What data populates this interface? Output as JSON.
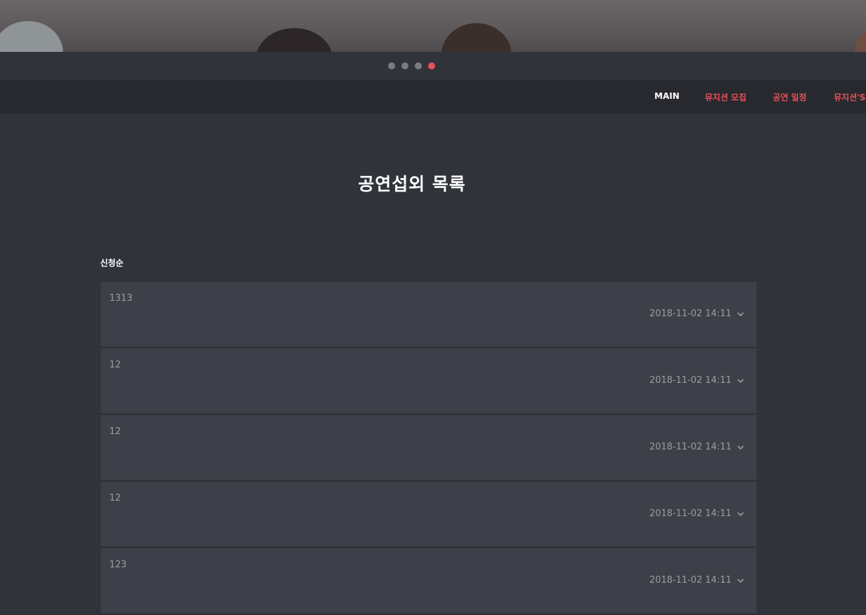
{
  "carousel": {
    "slide_count": 4,
    "active_index": 3,
    "colors": {
      "inactive": "#7a7c82",
      "active": "#e8515a"
    }
  },
  "nav": {
    "items": [
      {
        "label": "MAIN"
      },
      {
        "label": "뮤지션 모집"
      },
      {
        "label": "공연 일정"
      },
      {
        "label": "뮤지션'S"
      }
    ]
  },
  "page": {
    "title": "공연섭외 목록",
    "section_label": "신청순"
  },
  "list": {
    "items": [
      {
        "title": "1313",
        "date": "2018-11-02 14:11"
      },
      {
        "title": "12",
        "date": "2018-11-02 14:11"
      },
      {
        "title": "12",
        "date": "2018-11-02 14:11"
      },
      {
        "title": "12",
        "date": "2018-11-02 14:11"
      },
      {
        "title": "123",
        "date": "2018-11-02 14:11"
      }
    ],
    "row_icon": "chevron-down-icon"
  },
  "colors": {
    "background": "#31333b",
    "nav_background": "#27292e",
    "accent": "#e8515a",
    "row_background": "#3e4049"
  }
}
